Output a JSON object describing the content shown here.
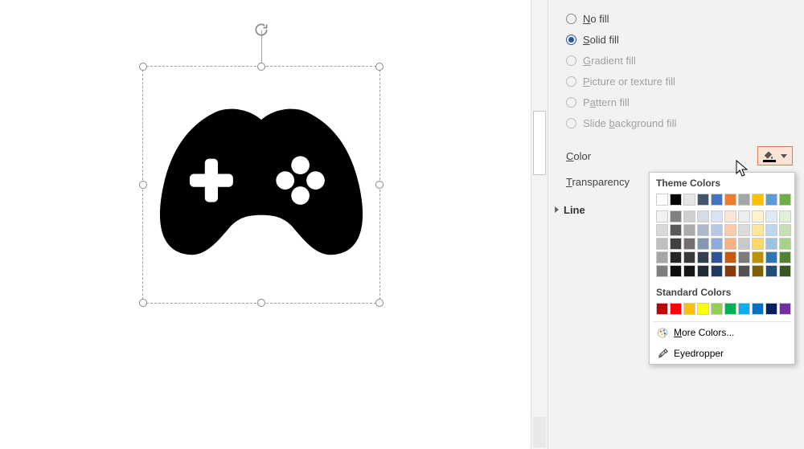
{
  "fill": {
    "options": {
      "no_fill": "No fill",
      "solid_fill": "Solid fill",
      "gradient_fill": "Gradient fill",
      "picture_fill": "Picture or texture fill",
      "pattern_fill": "Pattern fill",
      "slide_bg_fill": "Slide background fill"
    },
    "selected": "solid_fill",
    "color_label": "Color",
    "transparency_label": "Transparency"
  },
  "line_label": "Line",
  "popup": {
    "theme_header": "Theme Colors",
    "standard_header": "Standard Colors",
    "more_colors": "More Colors...",
    "eyedropper": "Eyedropper"
  },
  "colors": {
    "theme_row": [
      "#ffffff",
      "#000000",
      "#e7e6e6",
      "#44546a",
      "#4472c4",
      "#ed7d31",
      "#a5a5a5",
      "#ffc000",
      "#5b9bd5",
      "#70ad47"
    ],
    "theme_shades": [
      [
        "#f2f2f2",
        "#d9d9d9",
        "#bfbfbf",
        "#a6a6a6",
        "#7f7f7f"
      ],
      [
        "#808080",
        "#595959",
        "#404040",
        "#262626",
        "#0d0d0d"
      ],
      [
        "#d0cece",
        "#aeabab",
        "#757070",
        "#3b3838",
        "#171616"
      ],
      [
        "#d6dce5",
        "#adb9ca",
        "#8497b0",
        "#323f4f",
        "#222a35"
      ],
      [
        "#d9e2f3",
        "#b4c7e7",
        "#8faadc",
        "#2f5597",
        "#1f3864"
      ],
      [
        "#fbe5d6",
        "#f7cbac",
        "#f4b183",
        "#c55a11",
        "#833c0c"
      ],
      [
        "#ededed",
        "#dbdbdb",
        "#c9c9c9",
        "#7b7b7b",
        "#525252"
      ],
      [
        "#fff2cc",
        "#ffe699",
        "#ffd966",
        "#bf9000",
        "#7f6000"
      ],
      [
        "#deebf7",
        "#bdd7ee",
        "#9dc3e3",
        "#2e75b6",
        "#1f4e79"
      ],
      [
        "#e2f0d9",
        "#c5e0b4",
        "#a9d18e",
        "#548235",
        "#375623"
      ]
    ],
    "standard_row": [
      "#c00000",
      "#ff0000",
      "#ffc000",
      "#ffff00",
      "#92d050",
      "#00b050",
      "#00b0f0",
      "#0070c0",
      "#002060",
      "#7030a0"
    ]
  },
  "shape": {
    "name": "game-controller-icon",
    "fill": "#000000"
  }
}
